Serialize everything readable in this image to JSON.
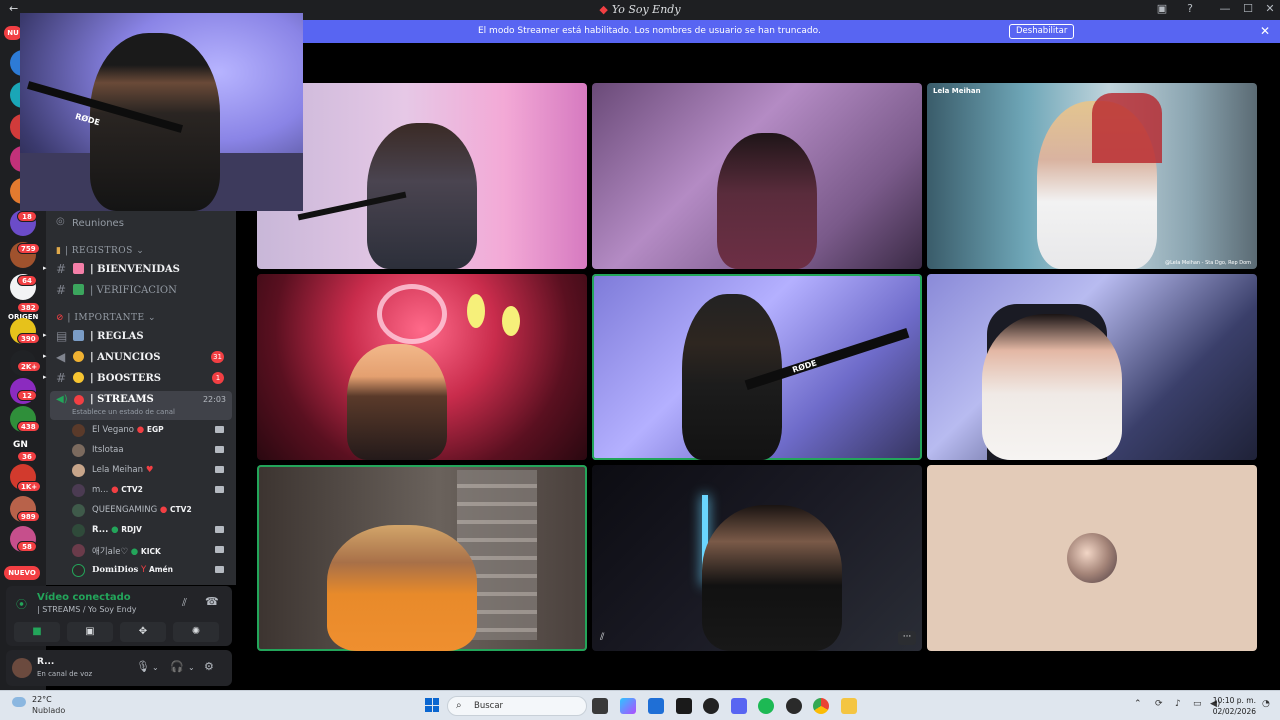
{
  "window": {
    "title": "Yo Soy Endy",
    "back_arrow": "←"
  },
  "banner": {
    "message": "El modo Streamer está habilitado. Los nombres de usuario se han truncado.",
    "button": "Deshabilitar",
    "close": "✕"
  },
  "rail": {
    "badges": [
      "18",
      "759",
      "64",
      "382",
      "390",
      "2K+",
      "12",
      "438",
      "36",
      "1K+",
      "989",
      "58"
    ],
    "top_badge": "NU",
    "nuevo": "NUEVO",
    "server_label_origen": "ORIGEN",
    "server_label_gn": "GN"
  },
  "sidebar": {
    "reuniones": "Reuniones",
    "cat_registros": "| REGISTROS",
    "ch_bienvenidas": "| BIENVENIDAS",
    "ch_verificacion": "| VERIFICACION",
    "cat_importante": "| IMPORTANTE",
    "ch_reglas": "| REGLAS",
    "ch_anuncios": "| ANUNCIOS",
    "ch_anuncios_count": "31",
    "ch_boosters": "| BOOSTERS",
    "ch_boosters_count": "1",
    "ch_streams": "| STREAMS",
    "ch_streams_time": "22:03",
    "ch_streams_status": "Establece un estado de canal",
    "members": [
      {
        "name": "El Vegano",
        "tag": "EGP"
      },
      {
        "name": "Itslotaa",
        "tag": ""
      },
      {
        "name": "Lela Meihan",
        "tag": ""
      },
      {
        "name": "m...",
        "tag": "CTV2"
      },
      {
        "name": "QUEENGAMING",
        "tag": "CTV2"
      },
      {
        "name": "R...",
        "tag": "RDJV"
      },
      {
        "name": "애기ale♡",
        "tag": "KICK"
      },
      {
        "name": "DomiDios",
        "tag": "Amén"
      }
    ]
  },
  "voice": {
    "state": "Vídeo conectado",
    "channel": "| STREAMS / Yo Soy Endy"
  },
  "user": {
    "name": "R...",
    "status": "En canal de voz"
  },
  "tiles": {
    "lela_name": "Lela Meihan",
    "lela_footer": "@Lela Meihan - Sta Dgo, Rep Dom",
    "rode": "RØDE",
    "more": "···"
  },
  "taskbar": {
    "temp": "22°C",
    "weather": "Nublado",
    "search": "Buscar",
    "time": "10:10 p. m.",
    "date": "02/02/2026"
  },
  "colors": {
    "accent": "#5865f2",
    "online": "#23a55a",
    "badge": "#f23f43"
  }
}
